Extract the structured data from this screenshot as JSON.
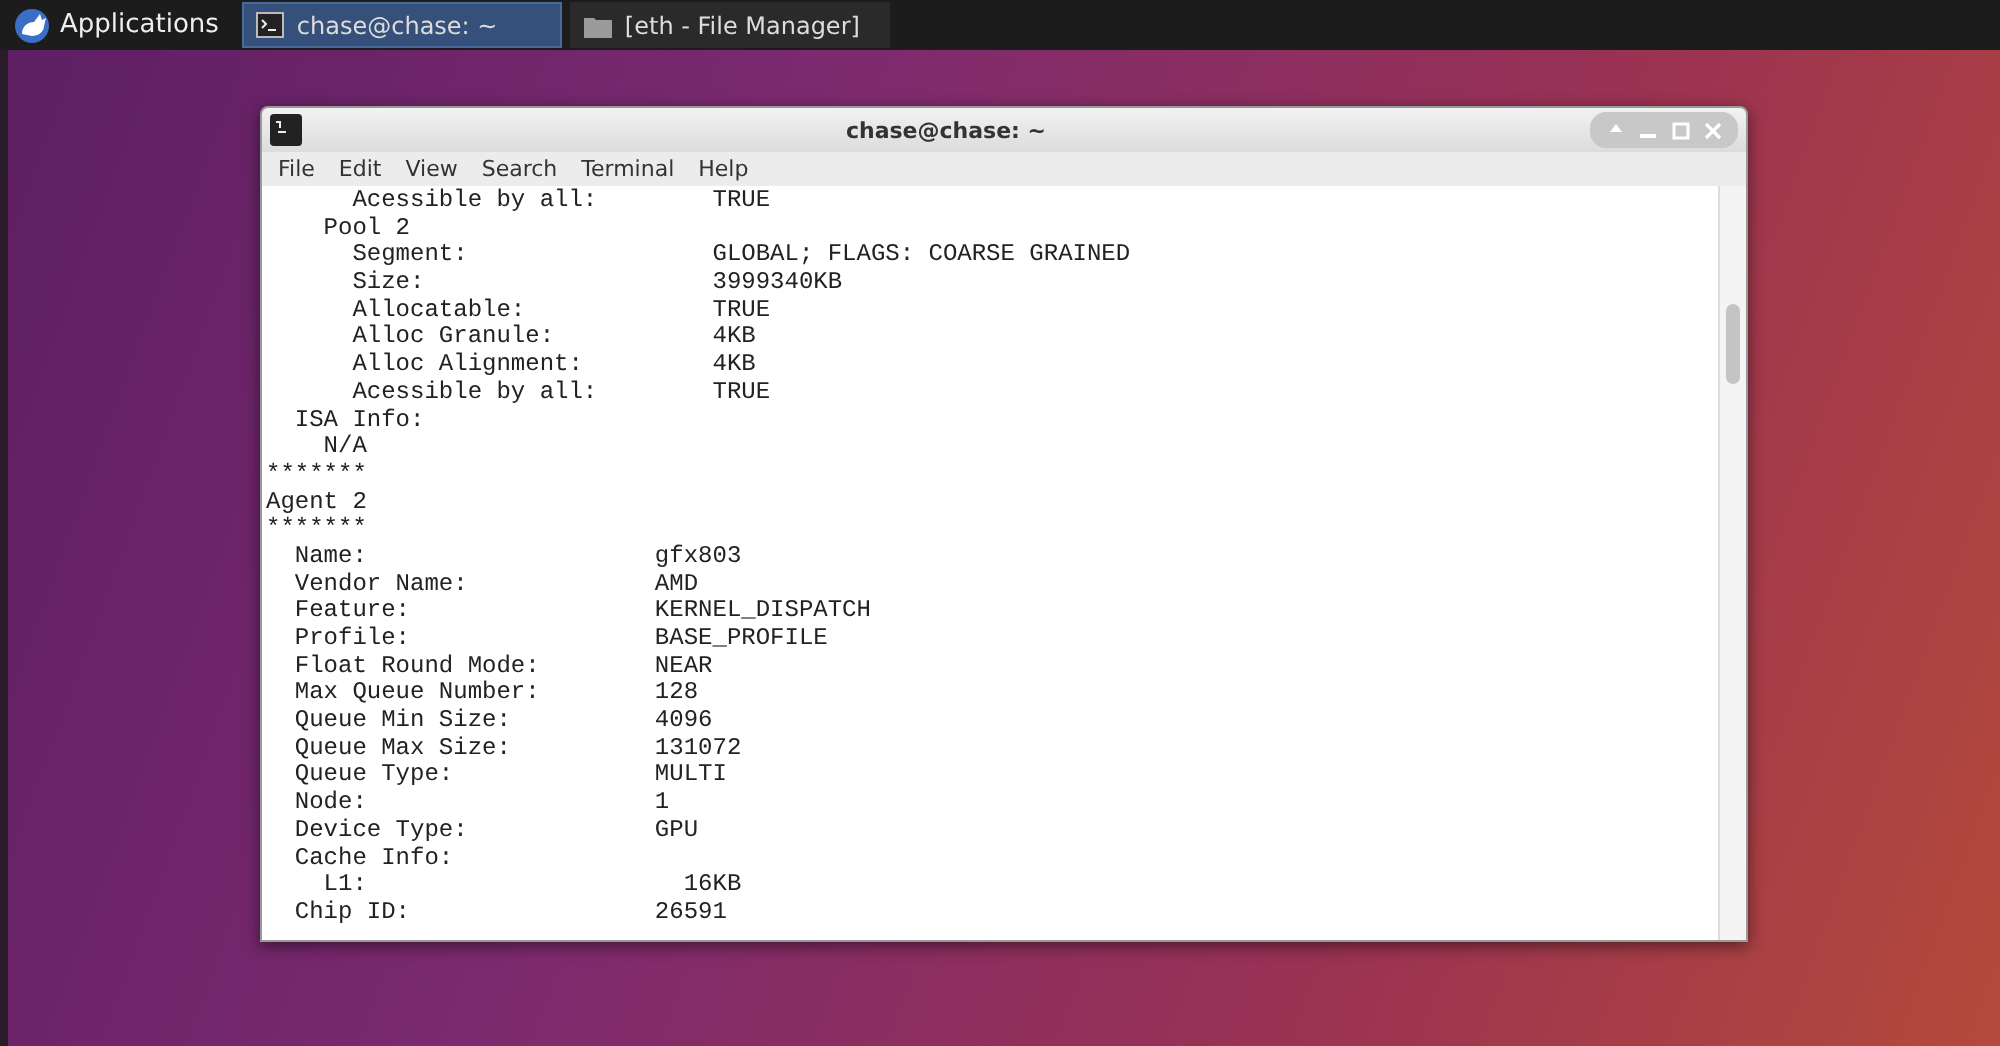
{
  "panel": {
    "apps_menu": "Applications",
    "tasks": [
      {
        "label": "chase@chase: ~",
        "kind": "terminal",
        "selected": true
      },
      {
        "label": "[eth - File Manager]",
        "kind": "folder",
        "selected": false
      }
    ]
  },
  "window": {
    "title": "chase@chase: ~",
    "menu": [
      "File",
      "Edit",
      "View",
      "Search",
      "Terminal",
      "Help"
    ],
    "lines": [
      "      Acessible by all:        TRUE",
      "    Pool 2",
      "      Segment:                 GLOBAL; FLAGS: COARSE GRAINED",
      "      Size:                    3999340KB",
      "      Allocatable:             TRUE",
      "      Alloc Granule:           4KB",
      "      Alloc Alignment:         4KB",
      "      Acessible by all:        TRUE",
      "  ISA Info:",
      "    N/A",
      "*******",
      "Agent 2",
      "*******",
      "  Name:                    gfx803",
      "  Vendor Name:             AMD",
      "  Feature:                 KERNEL_DISPATCH",
      "  Profile:                 BASE_PROFILE",
      "  Float Round Mode:        NEAR",
      "  Max Queue Number:        128",
      "  Queue Min Size:          4096",
      "  Queue Max Size:          131072",
      "  Queue Type:              MULTI",
      "  Node:                    1",
      "  Device Type:             GPU",
      "  Cache Info:",
      "    L1:                      16KB",
      "  Chip ID:                 26591"
    ]
  }
}
